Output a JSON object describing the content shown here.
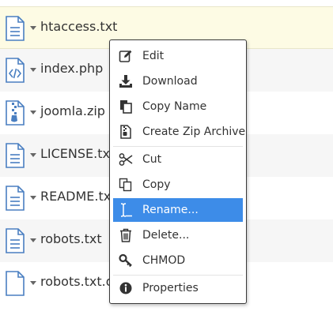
{
  "files": [
    {
      "name": "htaccess.txt",
      "icon": "text-file-icon"
    },
    {
      "name": "index.php",
      "icon": "code-file-icon"
    },
    {
      "name": "joomla.zip",
      "icon": "zip-file-icon"
    },
    {
      "name": "LICENSE.txt",
      "icon": "text-file-icon"
    },
    {
      "name": "README.txt",
      "icon": "text-file-icon"
    },
    {
      "name": "robots.txt",
      "icon": "text-file-icon"
    },
    {
      "name": "robots.txt.dist",
      "icon": "blank-file-icon"
    }
  ],
  "context_menu": {
    "items": [
      {
        "label": "Edit",
        "icon": "edit-icon"
      },
      {
        "label": "Download",
        "icon": "download-icon"
      },
      {
        "label": "Copy Name",
        "icon": "copy-name-icon"
      },
      {
        "label": "Create Zip Archive",
        "icon": "zip-archive-icon"
      },
      {
        "label": "Cut",
        "icon": "scissors-icon"
      },
      {
        "label": "Copy",
        "icon": "copy-icon"
      },
      {
        "label": "Rename...",
        "icon": "text-cursor-icon",
        "active": true
      },
      {
        "label": "Delete...",
        "icon": "trash-icon"
      },
      {
        "label": "CHMOD",
        "icon": "key-icon"
      },
      {
        "label": "Properties",
        "icon": "info-icon"
      }
    ]
  },
  "colors": {
    "highlight": "#3d8ce8",
    "selected_row": "#fdfbe4",
    "icon_blue": "#4a7fc1"
  }
}
